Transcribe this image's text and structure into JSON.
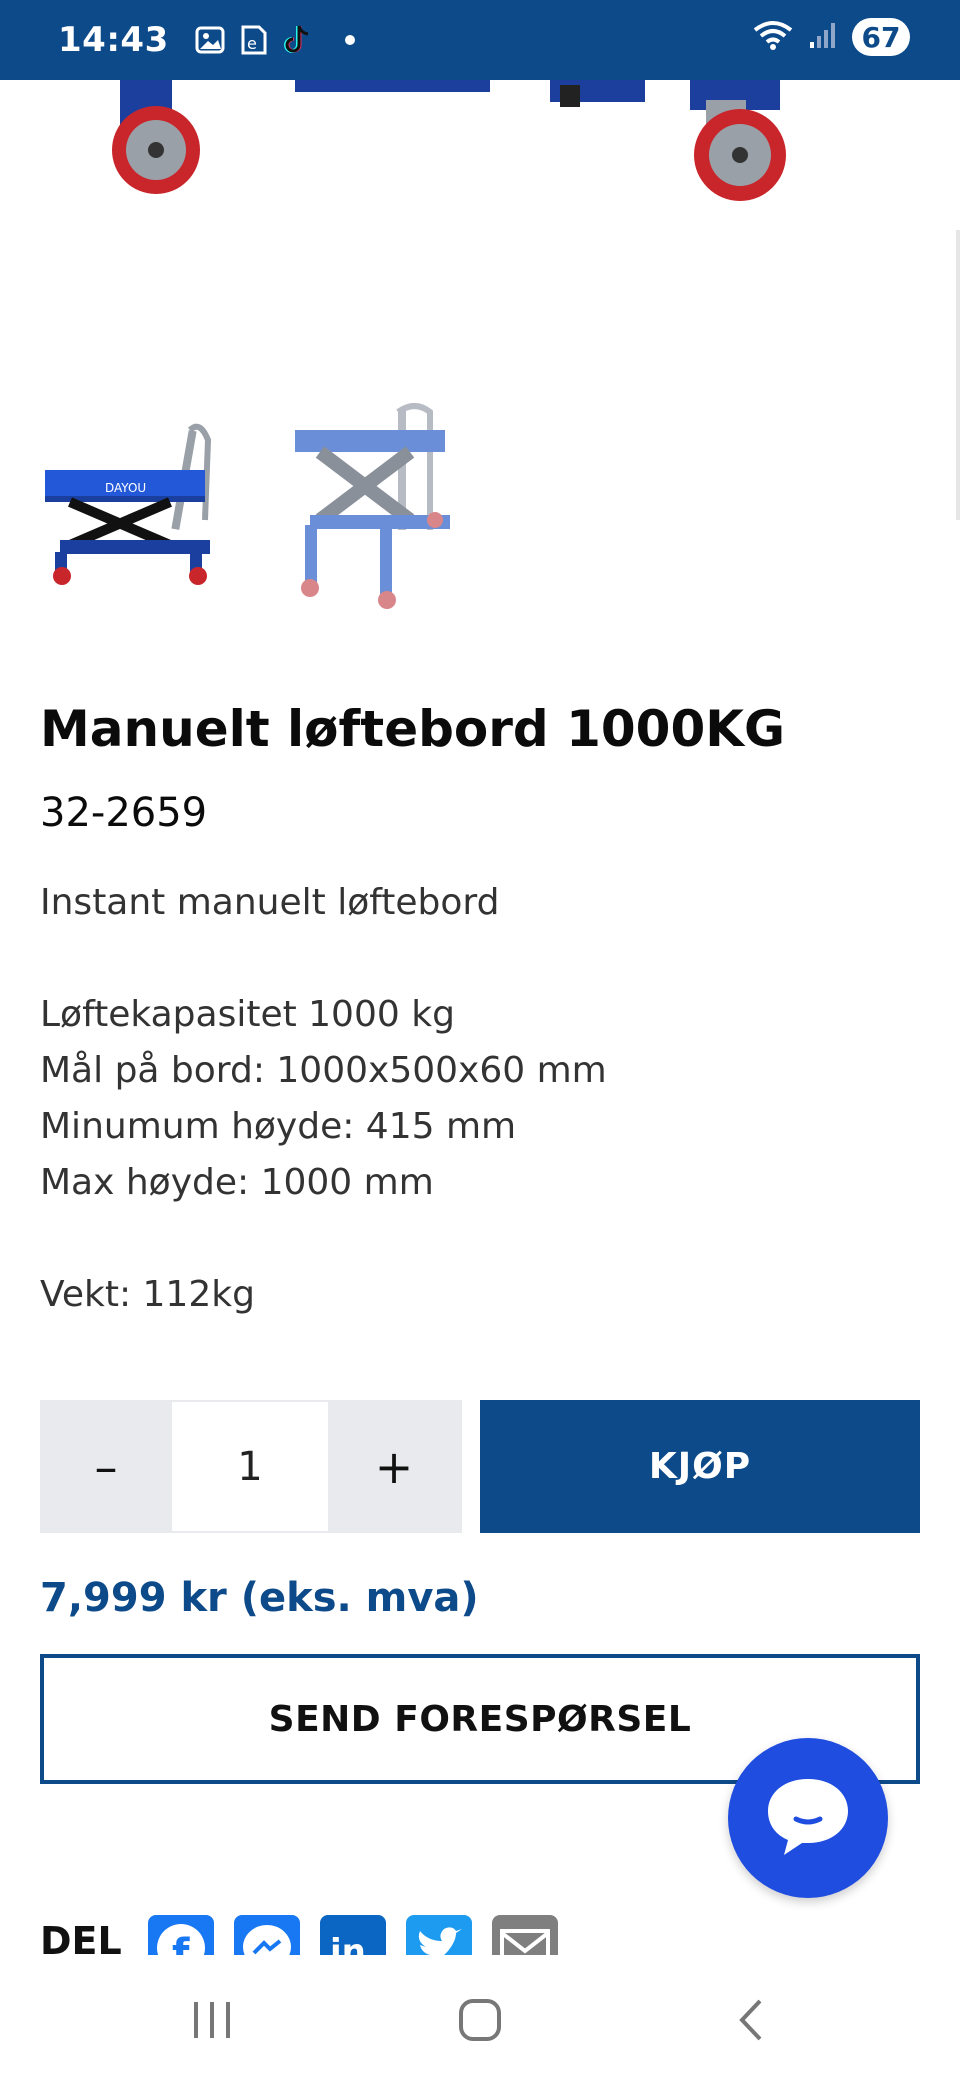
{
  "status_bar": {
    "time": "14:43",
    "battery": "67",
    "icons": [
      "gallery-icon",
      "e-notification-icon",
      "tiktok-icon",
      "wifi-icon",
      "signal-icon"
    ]
  },
  "product": {
    "title": "Manuelt løftebord 1000KG",
    "sku": "32-2659",
    "description": {
      "intro": "Instant manuelt løftebord",
      "specs": [
        "Løftekapasitet 1000 kg",
        "Mål på bord: 1000x500x60 mm",
        "Minumum høyde: 415 mm",
        "Max høyde: 1000 mm"
      ],
      "weight": "Vekt: 112kg"
    }
  },
  "cart": {
    "minus_label": "–",
    "quantity": "1",
    "plus_label": "+",
    "buy_label": "KJØP"
  },
  "price": "7,999 kr  (eks. mva)",
  "send_inquiry_label": "SEND FORESPØRSEL",
  "share": {
    "label": "DEL",
    "icons": [
      "facebook-icon",
      "messenger-icon",
      "linkedin-icon",
      "twitter-icon",
      "email-icon"
    ]
  },
  "colors": {
    "brand_blue": "#0d4a8a",
    "chat_blue": "#1f4de0",
    "qty_bg": "#e8eaed"
  }
}
